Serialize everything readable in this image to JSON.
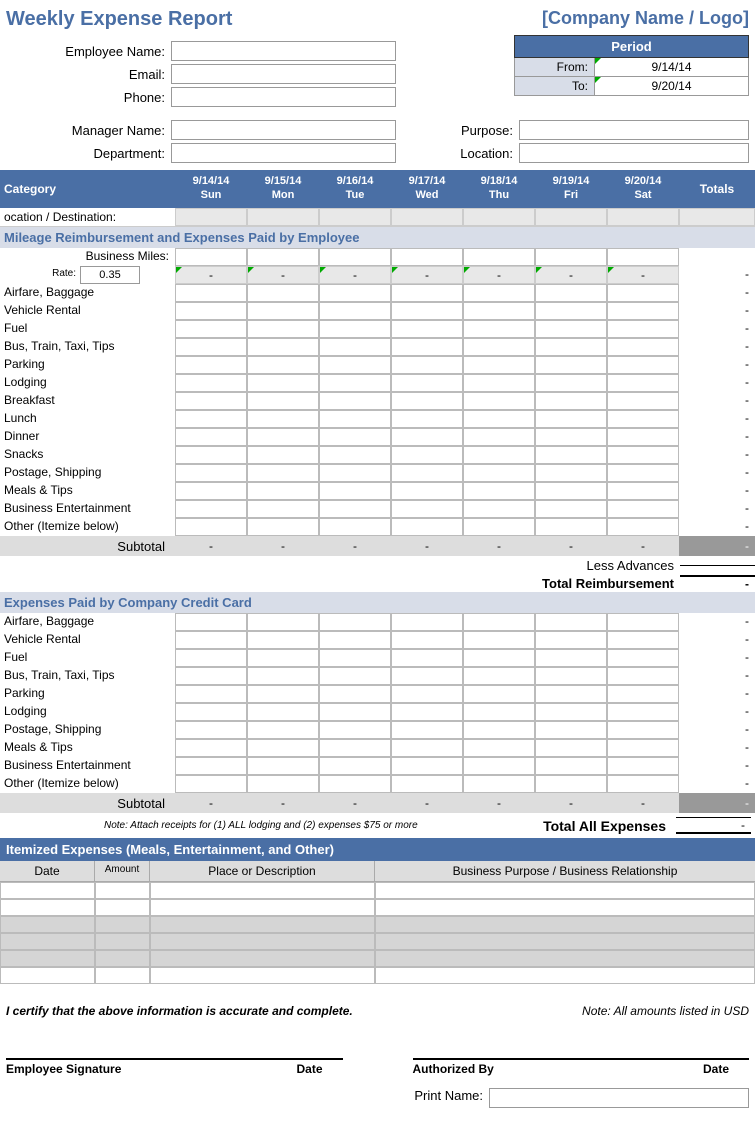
{
  "title": "Weekly Expense Report",
  "company": "[Company Name / Logo]",
  "labels": {
    "employee_name": "Employee Name:",
    "email": "Email:",
    "phone": "Phone:",
    "manager_name": "Manager Name:",
    "department": "Department:",
    "purpose": "Purpose:",
    "location": "Location:",
    "period": "Period",
    "from": "From:",
    "to": "To:",
    "category": "Category",
    "totals": "Totals",
    "location_dest": "ocation / Destination:",
    "business_miles": "Business Miles:",
    "rate": "Rate:",
    "subtotal": "Subtotal",
    "less_advances": "Less Advances",
    "total_reimbursement": "Total Reimbursement",
    "total_all_expenses": "Total All Expenses",
    "date": "Date",
    "amount": "Amount",
    "place": "Place or Description",
    "business_purpose": "Business Purpose / Business Relationship",
    "cert": "I certify that the above information is accurate and complete.",
    "cert_note": "Note: All amounts listed in USD",
    "employee_sig": "Employee Signature",
    "authorized_by": "Authorized By",
    "sig_date": "Date",
    "print_name": "Print Name:",
    "note": "Note:  Attach receipts for (1) ALL lodging and (2) expenses $75 or more"
  },
  "period": {
    "from": "9/14/14",
    "to": "9/20/14"
  },
  "days": [
    {
      "date": "9/14/14",
      "dow": "Sun"
    },
    {
      "date": "9/15/14",
      "dow": "Mon"
    },
    {
      "date": "9/16/14",
      "dow": "Tue"
    },
    {
      "date": "9/17/14",
      "dow": "Wed"
    },
    {
      "date": "9/18/14",
      "dow": "Thu"
    },
    {
      "date": "9/19/14",
      "dow": "Fri"
    },
    {
      "date": "9/20/14",
      "dow": "Sat"
    }
  ],
  "rate": "0.35",
  "dash": "-",
  "section1_title": "Mileage Reimbursement and Expenses Paid by Employee",
  "section2_title": "Expenses Paid by Company Credit Card",
  "section3_title": "Itemized Expenses (Meals, Entertainment, and Other)",
  "categories1": [
    "Airfare, Baggage",
    "Vehicle Rental",
    "Fuel",
    "Bus, Train, Taxi, Tips",
    "Parking",
    "Lodging",
    "Breakfast",
    "Lunch",
    "Dinner",
    "Snacks",
    "Postage, Shipping",
    "Meals & Tips",
    "Business Entertainment",
    "Other (Itemize below)"
  ],
  "categories2": [
    "Airfare, Baggage",
    "Vehicle Rental",
    "Fuel",
    "Bus, Train, Taxi, Tips",
    "Parking",
    "Lodging",
    "Postage, Shipping",
    "Meals & Tips",
    "Business Entertainment",
    "Other (Itemize below)"
  ]
}
